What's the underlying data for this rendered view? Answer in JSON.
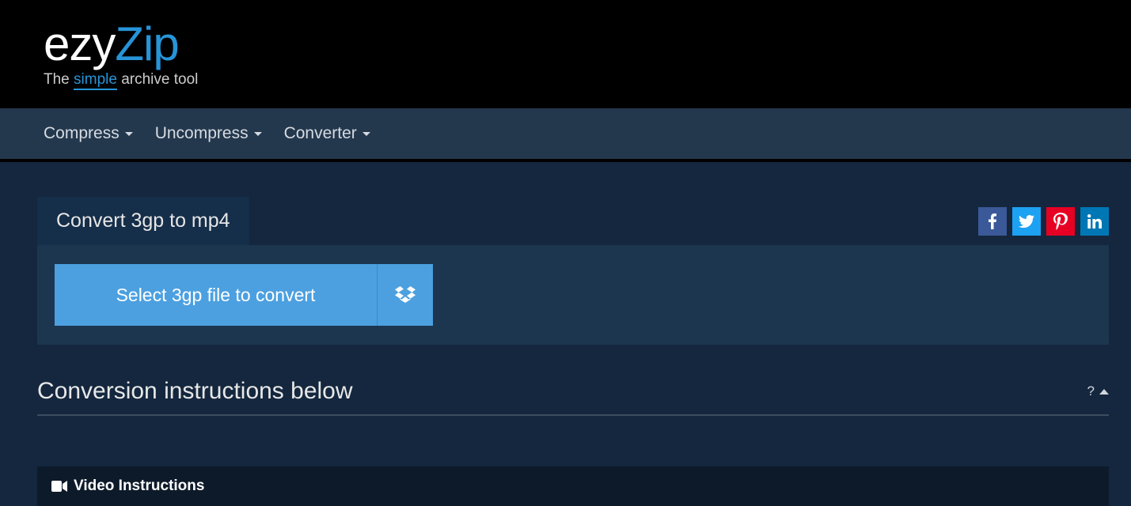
{
  "logo": {
    "part1": "ezy",
    "part2": "Zip"
  },
  "tagline": {
    "pre": "The ",
    "highlight": "simple",
    "post": " archive tool"
  },
  "nav": {
    "compress": "Compress",
    "uncompress": "Uncompress",
    "converter": "Converter"
  },
  "tab": {
    "title": "Convert 3gp to mp4"
  },
  "fileSelect": {
    "label": "Select 3gp file to convert"
  },
  "instructions": {
    "title": "Conversion instructions below",
    "help": "?"
  },
  "video": {
    "title": "Video Instructions"
  }
}
